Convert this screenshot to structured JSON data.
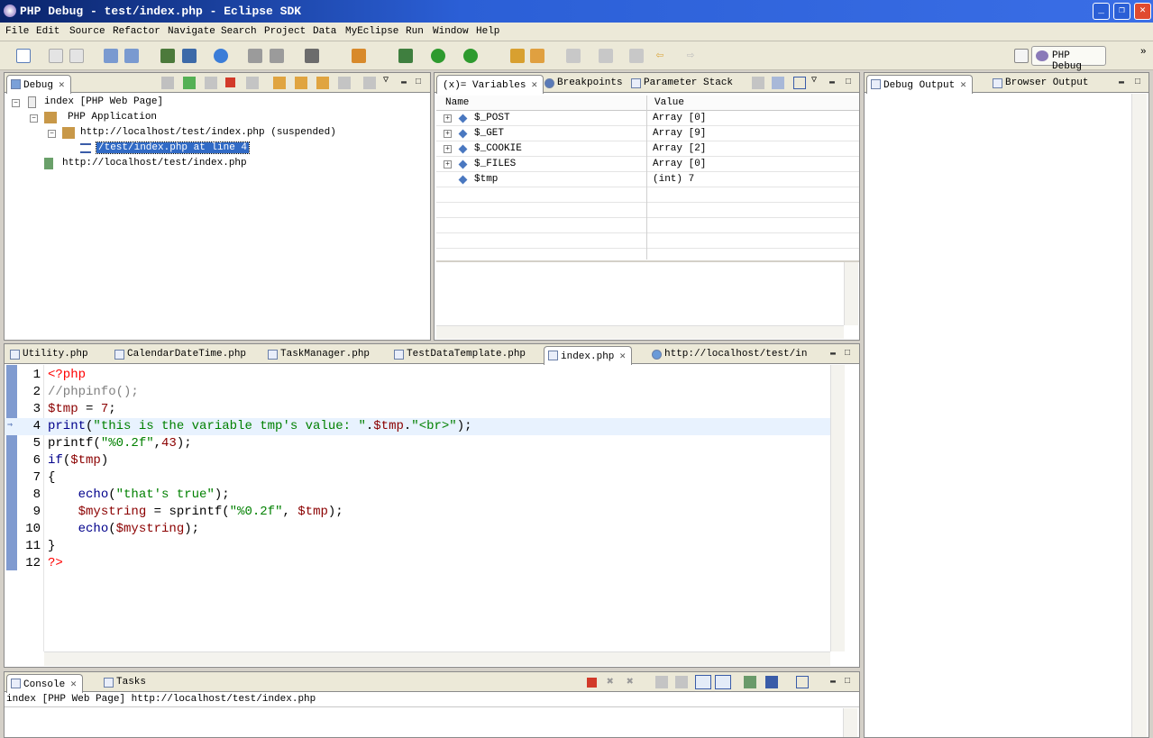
{
  "window": {
    "title": "PHP Debug - test/index.php - Eclipse SDK"
  },
  "menu": [
    "File",
    "Edit",
    "Source",
    "Refactor",
    "Navigate",
    "Search",
    "Project",
    "Data",
    "MyEclipse",
    "Run",
    "Window",
    "Help"
  ],
  "perspective": {
    "label": "PHP Debug"
  },
  "debug_view": {
    "tab": "Debug",
    "tree": [
      {
        "label": "index [PHP Web Page]",
        "level": 0,
        "icon": "php-page-icon"
      },
      {
        "label": "PHP Application",
        "level": 1,
        "icon": "application-icon"
      },
      {
        "label": "http://localhost/test/index.php (suspended)",
        "level": 2,
        "icon": "thread-icon"
      },
      {
        "label": "/test/index.php at line 4",
        "level": 3,
        "icon": "stack-frame-icon",
        "selected": true
      },
      {
        "label": "http://localhost/test/index.php",
        "level": 1,
        "icon": "process-icon"
      }
    ]
  },
  "variables_view": {
    "tabs": [
      "Variables",
      "Breakpoints",
      "Parameter Stack"
    ],
    "columns": {
      "name": "Name",
      "value": "Value"
    },
    "rows": [
      {
        "name": "$_POST",
        "value": "Array [0]",
        "expandable": true
      },
      {
        "name": "$_GET",
        "value": "Array [9]",
        "expandable": true
      },
      {
        "name": "$_COOKIE",
        "value": "Array [2]",
        "expandable": true
      },
      {
        "name": "$_FILES",
        "value": "Array [0]",
        "expandable": true
      },
      {
        "name": "$tmp",
        "value": "(int) 7",
        "expandable": false
      }
    ]
  },
  "output_view": {
    "tabs": [
      "Debug Output",
      "Browser Output"
    ]
  },
  "editor": {
    "tabs": [
      "Utility.php",
      "CalendarDateTime.php",
      "TaskManager.php",
      "TestDataTemplate.php",
      "index.php",
      "http://localhost/test/in"
    ],
    "active_tab": "index.php",
    "current_line": 4,
    "lines": [
      {
        "n": "1",
        "text": "<?php"
      },
      {
        "n": "2",
        "text": "//phpinfo();"
      },
      {
        "n": "3",
        "text": "$tmp = 7;"
      },
      {
        "n": "4",
        "text": "print(\"this is the variable tmp's value: \".$tmp.\"<br>\");"
      },
      {
        "n": "5",
        "text": "printf(\"%0.2f\",43);"
      },
      {
        "n": "6",
        "text": "if($tmp)"
      },
      {
        "n": "7",
        "text": "{"
      },
      {
        "n": "8",
        "text": "    echo(\"that's true\");"
      },
      {
        "n": "9",
        "text": "    $mystring = sprintf(\"%0.2f\", $tmp);"
      },
      {
        "n": "10",
        "text": "    echo($mystring);"
      },
      {
        "n": "11",
        "text": "}"
      },
      {
        "n": "12",
        "text": "?>"
      }
    ]
  },
  "console": {
    "tabs": [
      "Console",
      "Tasks"
    ],
    "header": "index [PHP Web Page] http://localhost/test/index.php"
  }
}
